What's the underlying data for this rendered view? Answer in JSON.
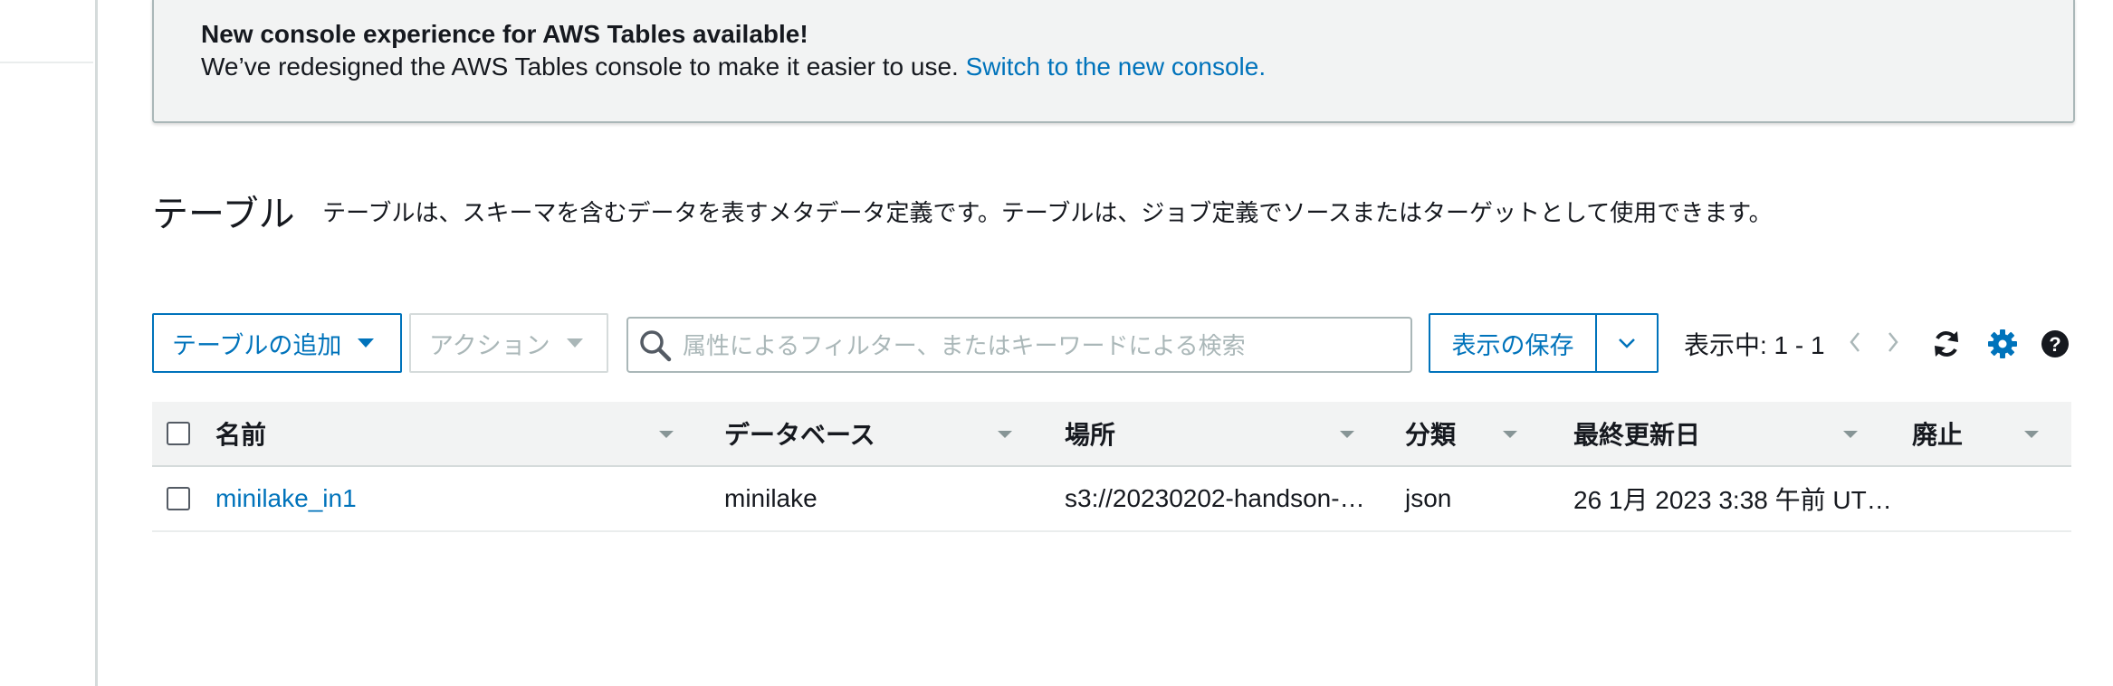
{
  "banner": {
    "title": "New console experience for AWS Tables available!",
    "body": "We’ve redesigned the AWS Tables console to make it easier to use.",
    "link": "Switch to the new console."
  },
  "header": {
    "title": "テーブル",
    "description": "テーブルは、スキーマを含むデータを表すメタデータ定義です。テーブルは、ジョブ定義でソースまたはターゲットとして使用できます。"
  },
  "toolbar": {
    "add_label": "テーブルの追加",
    "action_label": "アクション",
    "search_placeholder": "属性によるフィルター、またはキーワードによる検索",
    "save_view_label": "表示の保存",
    "pager_text": "表示中: 1 - 1"
  },
  "table": {
    "columns": [
      "名前",
      "データベース",
      "場所",
      "分類",
      "最終更新日",
      "廃止"
    ],
    "rows": [
      {
        "name": "minilake_in1",
        "database": "minilake",
        "location": "s3://20230202-handson-…",
        "classification": "json",
        "last_updated": "26 1月 2023 3:38 午前 UT…",
        "deprecated": ""
      }
    ]
  },
  "colors": {
    "link": "#0073bb",
    "border": "#aab7b8",
    "header_bg": "#f2f3f3",
    "disabled": "#aab7b8"
  },
  "icons": [
    "search-icon",
    "chevron-down-icon",
    "chevron-left-icon",
    "chevron-right-icon",
    "refresh-icon",
    "gear-icon",
    "help-icon"
  ]
}
